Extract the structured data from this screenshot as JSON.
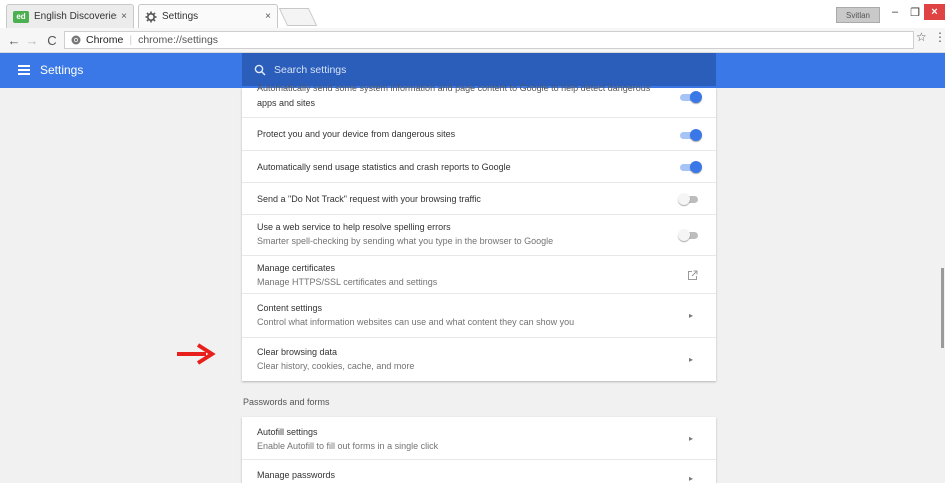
{
  "tabs": [
    {
      "label": "English Discoveries",
      "favicon": "ed",
      "close": "×"
    },
    {
      "label": "Settings",
      "favicon": "gear-icon",
      "close": "×"
    }
  ],
  "window": {
    "profile": "Svitlan",
    "minimize": "–",
    "maximize": "❐",
    "close": "×"
  },
  "toolbar": {
    "back": "←",
    "forward": "→",
    "reload": "C",
    "origin": "Chrome",
    "url": "chrome://settings",
    "star": "☆",
    "menu": "⋮"
  },
  "header": {
    "title": "Settings",
    "search_placeholder": "Search settings",
    "accent": "#3b78e7"
  },
  "privacy_rows": [
    {
      "title": "Automatically send some system information and page content to Google to help detect dangerous",
      "title2": "apps and sites",
      "control": "toggle",
      "state": true
    },
    {
      "title": "Protect you and your device from dangerous sites",
      "control": "toggle",
      "state": true
    },
    {
      "title": "Automatically send usage statistics and crash reports to Google",
      "control": "toggle",
      "state": true
    },
    {
      "title": "Send a \"Do Not Track\" request with your browsing traffic",
      "control": "toggle",
      "state": false
    },
    {
      "title": "Use a web service to help resolve spelling errors",
      "subtitle": "Smarter spell-checking by sending what you type in the browser to Google",
      "control": "toggle",
      "state": false
    },
    {
      "title": "Manage certificates",
      "subtitle": "Manage HTTPS/SSL certificates and settings",
      "control": "external-link-icon"
    },
    {
      "title": "Content settings",
      "subtitle": "Control what information websites can use and what content they can show you",
      "control": "chevron-right-icon"
    },
    {
      "title": "Clear browsing data",
      "subtitle": "Clear history, cookies, cache, and more",
      "control": "chevron-right-icon"
    }
  ],
  "passwords_section": {
    "title": "Passwords and forms",
    "rows": [
      {
        "title": "Autofill settings",
        "subtitle": "Enable Autofill to fill out forms in a single click",
        "control": "chevron-right-icon"
      },
      {
        "title": "Manage passwords",
        "control": "chevron-right-icon"
      }
    ]
  },
  "chevron_glyph": "▸",
  "annotation": {
    "arrow_color": "#e8201c"
  }
}
